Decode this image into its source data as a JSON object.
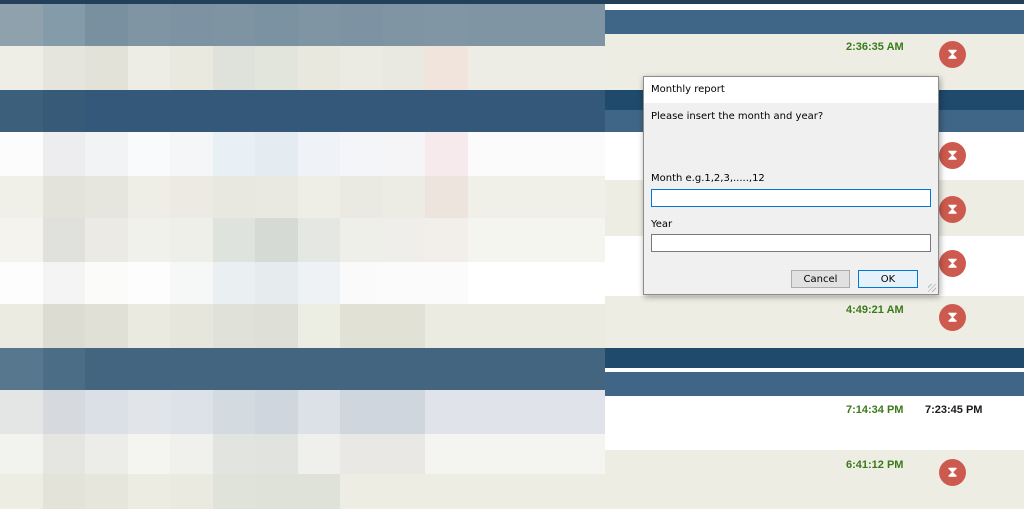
{
  "background": {
    "colors": {
      "header_band": "#3a5f7e",
      "row_beige": "#eeede4",
      "row_white": "#ffffff",
      "accent_green": "#3a7a1a",
      "hourglass_red": "#cd5a4f"
    }
  },
  "table": {
    "rows": [
      {
        "times": [
          "2:36:35 AM"
        ],
        "has_hourglass": true
      },
      {
        "times": [],
        "has_hourglass": true
      },
      {
        "times": [],
        "has_hourglass": true
      },
      {
        "times": [],
        "has_hourglass": true
      },
      {
        "times": [
          "4:49:21 AM"
        ],
        "has_hourglass": true
      },
      {
        "times": [
          "7:14:34 PM",
          "7:23:45 PM"
        ],
        "has_hourglass": false
      },
      {
        "times": [
          "6:41:12 PM"
        ],
        "has_hourglass": true
      }
    ],
    "hourglass_icon": "hourglass-icon"
  },
  "dialog": {
    "title": "Monthly report",
    "prompt": "Please insert the month and year?",
    "month_label": "Month e.g.1,2,3,.....,12",
    "month_value": "",
    "year_label": "Year",
    "year_value": "",
    "cancel_label": "Cancel",
    "ok_label": "OK"
  }
}
